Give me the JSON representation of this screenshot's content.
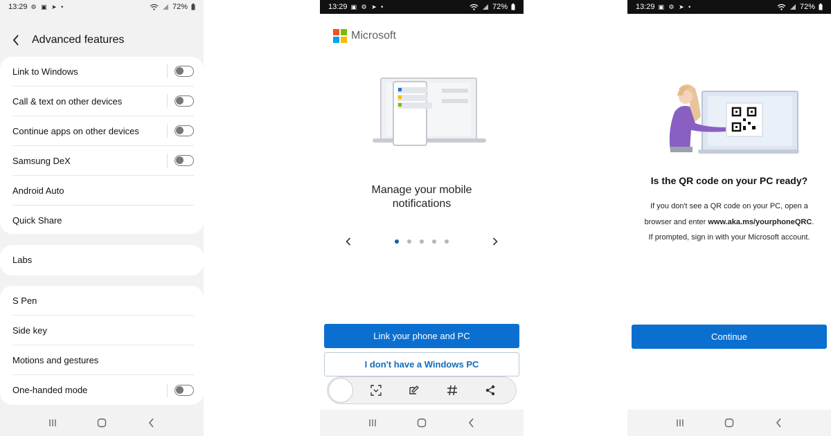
{
  "screen1": {
    "status": {
      "time": "13:29",
      "battery": "72%"
    },
    "header": {
      "title": "Advanced features"
    },
    "group1": [
      {
        "label": "Link to Windows",
        "toggle": "off"
      },
      {
        "label": "Call & text on other devices",
        "toggle": "off"
      },
      {
        "label": "Continue apps on other devices",
        "toggle": "off"
      },
      {
        "label": "Samsung DeX",
        "toggle": "off"
      },
      {
        "label": "Android Auto"
      },
      {
        "label": "Quick Share"
      }
    ],
    "group2": [
      {
        "label": "Labs"
      }
    ],
    "group3": [
      {
        "label": "S Pen"
      },
      {
        "label": "Side key"
      },
      {
        "label": "Motions and gestures"
      },
      {
        "label": "One-handed mode",
        "toggle": "off"
      }
    ]
  },
  "screen2": {
    "status": {
      "time": "13:29",
      "battery": "72%"
    },
    "brand": "Microsoft",
    "headline": "Manage your mobile\nnotifications",
    "pager": {
      "pages": 5,
      "active_index": 0
    },
    "primary_button": "Link your phone and PC",
    "secondary_button": "I don't have a Windows PC",
    "toolbar_icons": [
      "scan-icon",
      "edit-icon",
      "hashtag-icon",
      "share-icon"
    ]
  },
  "screen3": {
    "status": {
      "time": "13:29",
      "battery": "72%"
    },
    "title": "Is the QR code on your PC ready?",
    "body_part1": "If you don't see a QR code on your PC, open a browser and enter ",
    "body_link": "www.aka.ms/yourphoneQRC",
    "body_part2": ". If prompted, sign in with your Microsoft account.",
    "button": "Continue"
  },
  "colors": {
    "accent_blue": "#0b6fd0",
    "pager_active": "#0f62a8",
    "ms_red": "#f25022",
    "ms_green": "#7fba00",
    "ms_blue": "#00a4ef",
    "ms_yellow": "#ffb900",
    "illustration_purple": "#8a5fc2"
  }
}
